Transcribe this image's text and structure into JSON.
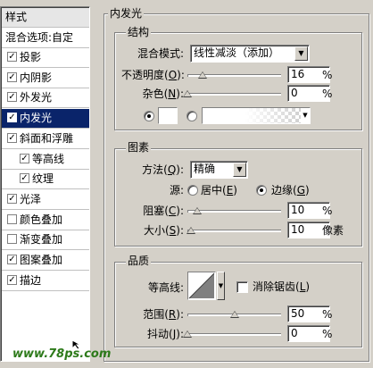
{
  "sidebar": {
    "header": "样式",
    "blend_options": "混合选项:自定",
    "items": [
      {
        "label": "投影",
        "checked": true,
        "indent": false
      },
      {
        "label": "内阴影",
        "checked": true,
        "indent": false
      },
      {
        "label": "外发光",
        "checked": true,
        "indent": false
      },
      {
        "label": "内发光",
        "checked": true,
        "indent": false,
        "selected": true
      },
      {
        "label": "斜面和浮雕",
        "checked": true,
        "indent": false
      },
      {
        "label": "等高线",
        "checked": true,
        "indent": true
      },
      {
        "label": "纹理",
        "checked": true,
        "indent": true
      },
      {
        "label": "光泽",
        "checked": true,
        "indent": false
      },
      {
        "label": "颜色叠加",
        "checked": false,
        "indent": false
      },
      {
        "label": "渐变叠加",
        "checked": false,
        "indent": false
      },
      {
        "label": "图案叠加",
        "checked": true,
        "indent": false
      },
      {
        "label": "描边",
        "checked": true,
        "indent": false
      }
    ],
    "checkmark": "✓"
  },
  "panel": {
    "title": "内发光",
    "structure": {
      "title": "结构",
      "blend_mode_label": "混合模式:",
      "blend_mode_value": "线性减淡（添加）",
      "opacity_label": "不透明度(",
      "opacity_key": "O",
      "opacity_label_end": "):",
      "opacity_value": "16",
      "opacity_unit": "%",
      "opacity_fraction": 0.16,
      "noise_label": "杂色(",
      "noise_key": "N",
      "noise_label_end": "):",
      "noise_value": "0",
      "noise_unit": "%",
      "noise_fraction": 0.0,
      "color_radio_selected": true,
      "gradient_radio_selected": false,
      "glow_color": "#ffffff"
    },
    "elements": {
      "title": "图素",
      "technique_label": "方法(",
      "technique_key": "Q",
      "technique_label_end": "):",
      "technique_value": "精确",
      "source_label": "源:",
      "source_center": "居中(",
      "source_center_key": "E",
      "source_edge": "边缘(",
      "source_edge_key": "G",
      "source_close": ")",
      "source_selected": "edge",
      "choke_label": "阻塞(",
      "choke_key": "C",
      "choke_label_end": "):",
      "choke_value": "10",
      "choke_unit": "%",
      "choke_fraction": 0.1,
      "size_label": "大小(",
      "size_key": "S",
      "size_label_end": "):",
      "size_value": "10",
      "size_unit": "像素",
      "size_fraction": 0.04
    },
    "quality": {
      "title": "品质",
      "contour_label": "等高线:",
      "antialias_label": "消除锯齿(",
      "antialias_key": "L",
      "antialias_label_end": ")",
      "antialias_checked": false,
      "range_label": "范围(",
      "range_key": "R",
      "range_label_end": "):",
      "range_value": "50",
      "range_unit": "%",
      "range_fraction": 0.5,
      "jitter_label": "抖动(",
      "jitter_key": "J",
      "jitter_label_end": "):",
      "jitter_value": "0",
      "jitter_unit": "%",
      "jitter_fraction": 0.0
    }
  },
  "watermark": "www.78ps.com"
}
